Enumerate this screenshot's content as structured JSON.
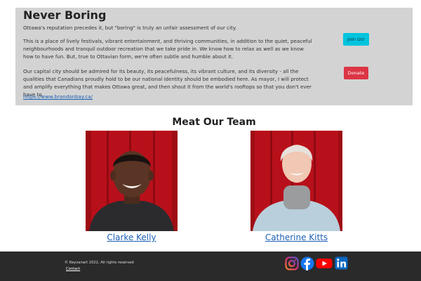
{
  "intro": {
    "title": "Never Boring",
    "paragraph_1": "Ottawa's reputation precedes it, but \"boring\" is truly an unfair assessment of our city.",
    "paragraph_2": "This is a place of lively festivals, vibrant entertainment, and thriving communities, in addition to the quiet, peaceful neighbourhoods and tranquil outdoor recreation that we take pride in. We know how to relax as well as we know how to have fun. But, true to Ottavian form, we're often subtle and humble about it.",
    "paragraph_3": "Our capital city should be admired for its beauty, its peacefulness, its vibrant culture, and its diversity - all the qualities that Canadians proudly hold to be our national identity should be embodied here. As mayor, I will protect and amplify everything that makes Ottawa great, and then shout it from the world's rooftops so that you don't ever have to.",
    "link": "https://www.brandonbay.ca/",
    "join_button": "Join Us!",
    "donate_button": "Donate"
  },
  "team": {
    "heading": "Meat Our Team",
    "members": [
      {
        "name": "Clarke Kelly"
      },
      {
        "name": "Catherine Kitts"
      }
    ]
  },
  "footer": {
    "copyright": "© Keyvanart 2022, All rights reserved",
    "contact": "Contact",
    "social_icons": [
      "instagram-icon",
      "facebook-icon",
      "youtube-icon",
      "linkedin-icon"
    ]
  },
  "colors": {
    "intro_background": "#d3d3d3",
    "join_button": "#00c4de",
    "donate_button": "#dc3545",
    "link": "#1a5fb4",
    "footer_background": "#2a2a2a",
    "photo_background": "#c0131b"
  }
}
